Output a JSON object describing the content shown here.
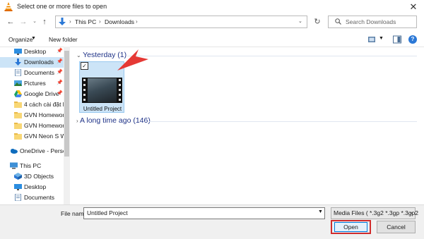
{
  "window": {
    "title": "Select one or more files to open"
  },
  "address": {
    "crumbs": [
      "This PC",
      "Downloads"
    ]
  },
  "search": {
    "placeholder": "Search Downloads"
  },
  "toolbar": {
    "organize": "Organize",
    "new_folder": "New folder",
    "help": "?"
  },
  "nav": {
    "items": [
      {
        "label": "Desktop",
        "icon": "desktop-icon",
        "pinned": true
      },
      {
        "label": "Downloads",
        "icon": "download-icon",
        "pinned": true,
        "selected": true
      },
      {
        "label": "Documents",
        "icon": "documents-icon",
        "pinned": true
      },
      {
        "label": "Pictures",
        "icon": "pictures-icon",
        "pinned": true
      },
      {
        "label": "Google Drive",
        "icon": "google-drive-icon",
        "pinned": true
      },
      {
        "label": "4 cách cài đặt hì",
        "icon": "folder-icon"
      },
      {
        "label": "GVN Homework",
        "icon": "folder-icon"
      },
      {
        "label": "GVN Homework",
        "icon": "folder-icon"
      },
      {
        "label": "GVN Neon S Wh",
        "icon": "folder-icon"
      },
      {
        "label": "OneDrive - Persor",
        "icon": "onedrive-icon"
      },
      {
        "label": "This PC",
        "icon": "pc-icon"
      },
      {
        "label": "3D Objects",
        "icon": "3d-objects-icon"
      },
      {
        "label": "Desktop",
        "icon": "desktop-icon"
      },
      {
        "label": "Documents",
        "icon": "documents-icon"
      }
    ]
  },
  "content": {
    "group1": "Yesterday (1)",
    "group2": "A long time ago (146)",
    "file": {
      "name": "Untitled Project",
      "checked": true
    }
  },
  "footer": {
    "file_name_label": "File name:",
    "file_name_value": "Untitled Project",
    "filter": "Media Files ( *.3g2 *.3gp *.3gp2",
    "open": "Open",
    "cancel": "Cancel"
  },
  "colors": {
    "accent": "#0078d7",
    "selection": "#cce4f7",
    "highlight": "#d12c2c",
    "arrow": "#e53935"
  }
}
